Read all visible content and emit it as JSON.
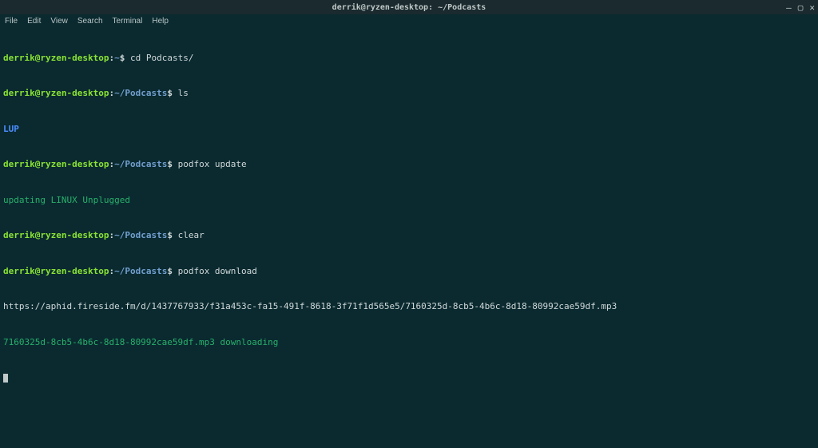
{
  "window": {
    "title": "derrik@ryzen-desktop: ~/Podcasts",
    "controls": {
      "min": "—",
      "max": "▢",
      "close": "✕"
    }
  },
  "menu": {
    "file": "File",
    "edit": "Edit",
    "view": "View",
    "search": "Search",
    "terminal": "Terminal",
    "help": "Help"
  },
  "prompt": {
    "user": "derrik",
    "at": "@",
    "host": "ryzen-desktop",
    "colon": ":",
    "tilde": "~",
    "path_podcasts": "/Podcasts",
    "dollar": "$ "
  },
  "lines": {
    "l1_cmd": "cd Podcasts/",
    "l2_cmd": "ls",
    "l3_out": "LUP",
    "l4_cmd": "podfox update",
    "l5_out": "updating LINUX Unplugged",
    "l6_cmd": "clear",
    "l7_cmd": "podfox download",
    "l8_out": "https://aphid.fireside.fm/d/1437767933/f31a453c-fa15-491f-8618-3f71f1d565e5/7160325d-8cb5-4b6c-8d18-80992cae59df.mp3",
    "l9_out": "7160325d-8cb5-4b6c-8d18-80992cae59df.mp3 downloading"
  }
}
